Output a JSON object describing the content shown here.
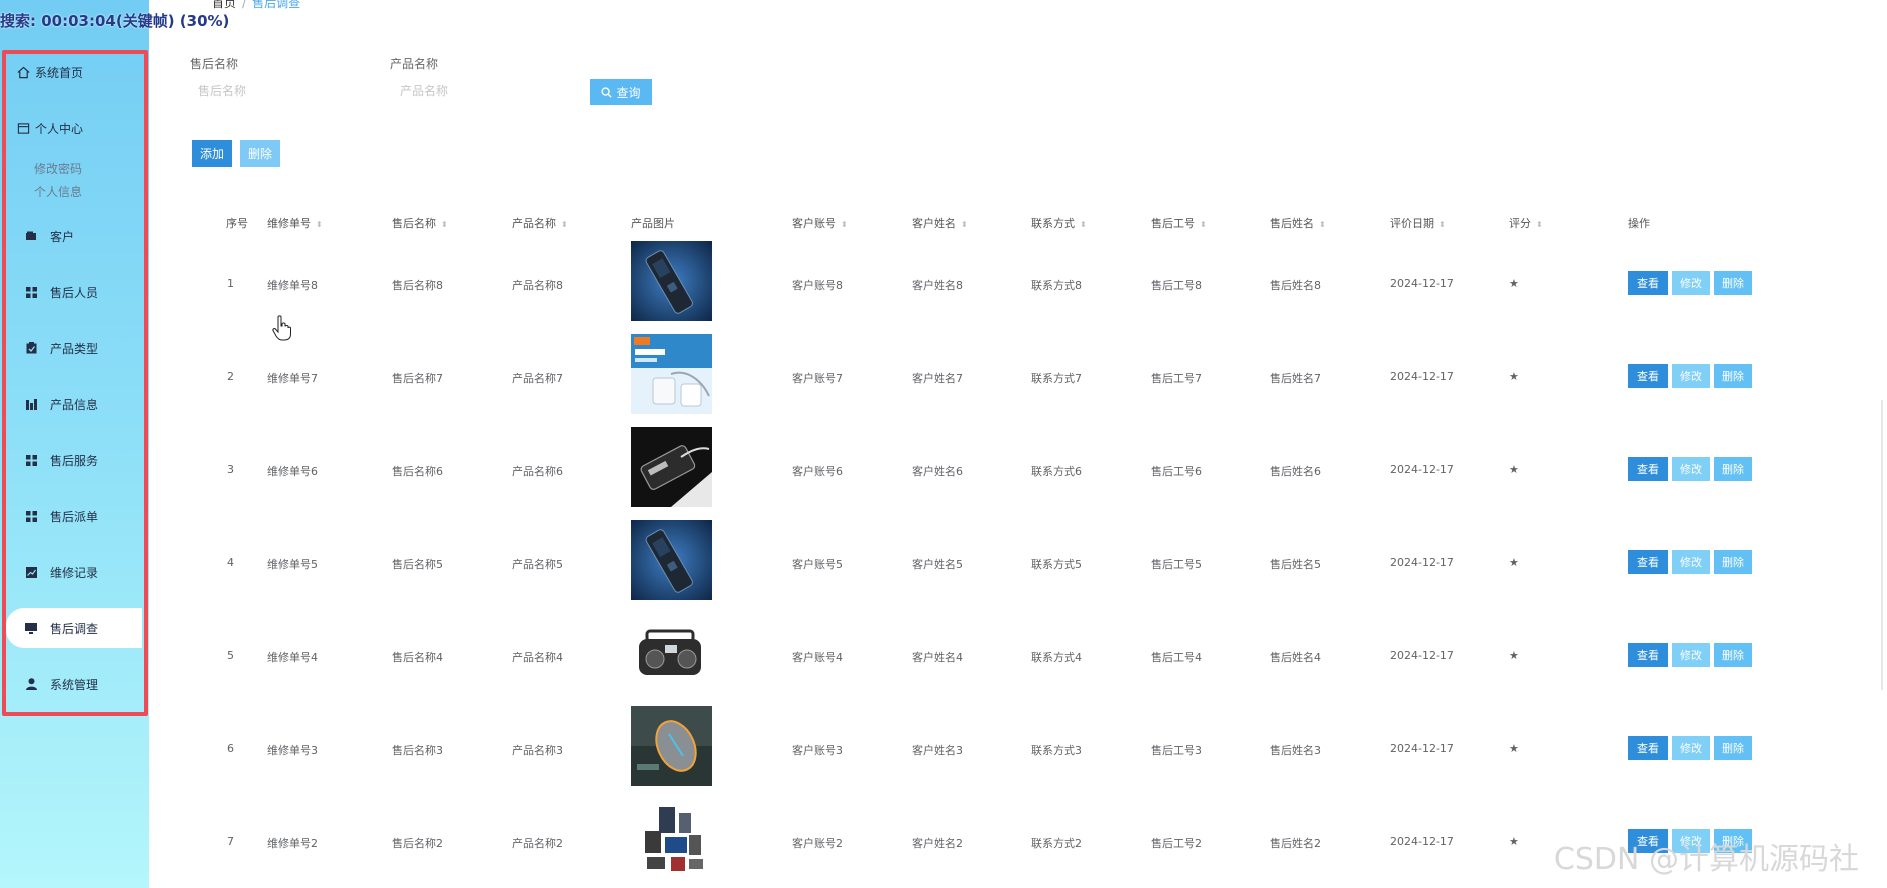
{
  "overlay_title": "搜索: 00:03:04(关键帧) (30%)",
  "breadcrumb": {
    "home": "首页",
    "separator": "/",
    "current": "售后调查"
  },
  "sidebar": {
    "items": [
      {
        "label": "系统首页",
        "icon": "home-icon"
      },
      {
        "label": "个人中心",
        "icon": "user-card-icon"
      },
      {
        "label": "客户",
        "icon": "wallet-icon"
      },
      {
        "label": "售后人员",
        "icon": "grid-icon"
      },
      {
        "label": "产品类型",
        "icon": "clipboard-icon"
      },
      {
        "label": "产品信息",
        "icon": "chart-icon"
      },
      {
        "label": "售后服务",
        "icon": "grid-icon"
      },
      {
        "label": "售后派单",
        "icon": "grid-icon"
      },
      {
        "label": "维修记录",
        "icon": "line-chart-icon"
      },
      {
        "label": "售后调查",
        "icon": "monitor-icon"
      },
      {
        "label": "系统管理",
        "icon": "person-icon"
      }
    ],
    "sub_items": [
      "修改密码",
      "个人信息"
    ]
  },
  "search": {
    "after_sale_label": "售后名称",
    "after_sale_placeholder": "售后名称",
    "product_label": "产品名称",
    "product_placeholder": "产品名称",
    "search_button": "查询"
  },
  "actions": {
    "add": "添加",
    "delete": "删除"
  },
  "table": {
    "headers": [
      "序号",
      "维修单号",
      "售后名称",
      "产品名称",
      "产品图片",
      "客户账号",
      "客户姓名",
      "联系方式",
      "售后工号",
      "售后姓名",
      "评价日期",
      "评分",
      "操作"
    ],
    "rows": [
      {
        "index": "1",
        "repair_no": "维修单号8",
        "after_sale": "售后名称8",
        "product": "产品名称8",
        "account": "客户账号8",
        "customer": "客户姓名8",
        "contact": "联系方式8",
        "staff_no": "售后工号8",
        "staff_name": "售后姓名8",
        "date": "2024-12-17",
        "rating": "★"
      },
      {
        "index": "2",
        "repair_no": "维修单号7",
        "after_sale": "售后名称7",
        "product": "产品名称7",
        "account": "客户账号7",
        "customer": "客户姓名7",
        "contact": "联系方式7",
        "staff_no": "售后工号7",
        "staff_name": "售后姓名7",
        "date": "2024-12-17",
        "rating": "★"
      },
      {
        "index": "3",
        "repair_no": "维修单号6",
        "after_sale": "售后名称6",
        "product": "产品名称6",
        "account": "客户账号6",
        "customer": "客户姓名6",
        "contact": "联系方式6",
        "staff_no": "售后工号6",
        "staff_name": "售后姓名6",
        "date": "2024-12-17",
        "rating": "★"
      },
      {
        "index": "4",
        "repair_no": "维修单号5",
        "after_sale": "售后名称5",
        "product": "产品名称5",
        "account": "客户账号5",
        "customer": "客户姓名5",
        "contact": "联系方式5",
        "staff_no": "售后工号5",
        "staff_name": "售后姓名5",
        "date": "2024-12-17",
        "rating": "★"
      },
      {
        "index": "5",
        "repair_no": "维修单号4",
        "after_sale": "售后名称4",
        "product": "产品名称4",
        "account": "客户账号4",
        "customer": "客户姓名4",
        "contact": "联系方式4",
        "staff_no": "售后工号4",
        "staff_name": "售后姓名4",
        "date": "2024-12-17",
        "rating": "★"
      },
      {
        "index": "6",
        "repair_no": "维修单号3",
        "after_sale": "售后名称3",
        "product": "产品名称3",
        "account": "客户账号3",
        "customer": "客户姓名3",
        "contact": "联系方式3",
        "staff_no": "售后工号3",
        "staff_name": "售后姓名3",
        "date": "2024-12-17",
        "rating": "★"
      },
      {
        "index": "7",
        "repair_no": "维修单号2",
        "after_sale": "售后名称2",
        "product": "产品名称2",
        "account": "客户账号2",
        "customer": "客户姓名2",
        "contact": "联系方式2",
        "staff_no": "售后工号2",
        "staff_name": "售后姓名2",
        "date": "2024-12-17",
        "rating": "★"
      }
    ],
    "row_actions": {
      "view": "查看",
      "edit": "修改",
      "delete": "删除"
    }
  },
  "watermark": "CSDN @计算机源码社",
  "colors": {
    "primary": "#2e8edb",
    "light_blue": "#7fc9f7",
    "sidebar_border": "#ee4b54"
  }
}
